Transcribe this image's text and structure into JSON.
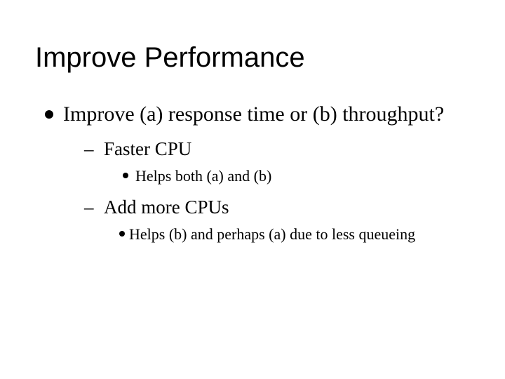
{
  "title": "Improve Performance",
  "bullets": {
    "main": "Improve (a) response time or (b) throughput?",
    "sub1": "Faster CPU",
    "sub1_detail": "Helps both (a) and (b)",
    "sub2": "Add more CPUs",
    "sub2_detail": "Helps (b) and perhaps (a) due to less queueing"
  }
}
